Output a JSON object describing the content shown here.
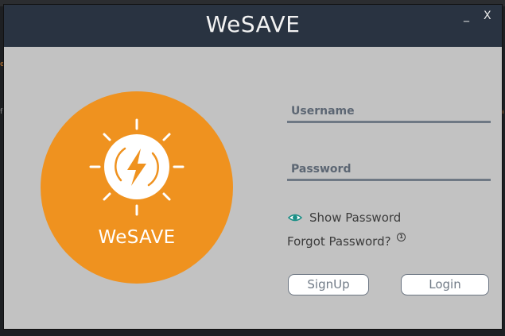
{
  "window": {
    "title": "WeSAVE",
    "minimize_label": "_",
    "close_label": "X"
  },
  "logo": {
    "text": "WeSAVE",
    "icon": "sun-lightning-icon",
    "color": "#ef921f"
  },
  "form": {
    "username_placeholder": "Username",
    "password_placeholder": "Password",
    "show_password_label": "Show Password",
    "forgot_password_label": "Forgot Password?",
    "info_icon_glyph": "1",
    "signup_label": "SignUp",
    "login_label": "Login"
  },
  "colors": {
    "titlebar": "#293341",
    "window_bg": "#c2c2c2",
    "accent": "#ef921f",
    "eye_icon": "#1a8f86"
  }
}
